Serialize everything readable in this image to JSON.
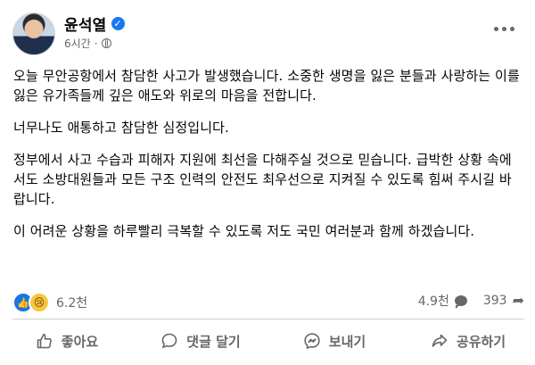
{
  "post": {
    "author": "윤석열",
    "time": "6시간",
    "separator": "·",
    "paragraphs": [
      "오늘 무안공항에서 참담한 사고가 발생했습니다. 소중한 생명을 잃은 분들과 사랑하는 이를 잃은 유가족들께 깊은 애도와 위로의 마음을 전합니다.",
      "너무나도 애통하고 참담한 심정입니다.",
      "정부에서 사고 수습과 피해자 지원에 최선을 다해주실 것으로 믿습니다. 급박한 상황 속에서도 소방대원들과 모든 구조 인력의 안전도 최우선으로 지켜질 수 있도록 힘써 주시길 바랍니다.",
      "이 어려운 상황을 하루빨리 극복할 수 있도록 저도 국민 여러분과 함께 하겠습니다."
    ]
  },
  "stats": {
    "reactions": "6.2천",
    "comments": "4.9천",
    "shares": "393"
  },
  "actions": {
    "like": "좋아요",
    "comment": "댓글 달기",
    "send": "보내기",
    "share": "공유하기"
  },
  "colors": {
    "accent": "#1877f2",
    "muted": "#65676b"
  },
  "icons": {
    "verified": "verified-badge-icon",
    "privacy": "globe-icon",
    "menu": "more-icon",
    "like": "thumbs-up-icon",
    "comment": "comment-icon",
    "send": "messenger-icon",
    "share": "share-icon"
  }
}
